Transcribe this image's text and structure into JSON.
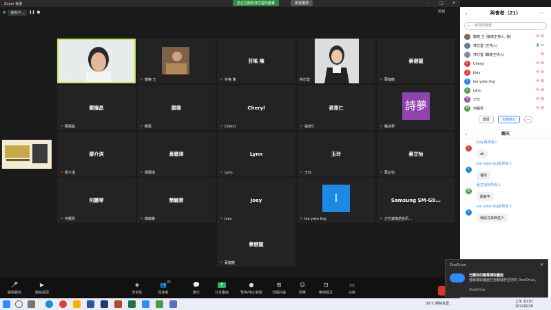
{
  "window": {
    "app_title": "Zoom 會議"
  },
  "share_banner": {
    "text": "您正在觀看林芯瑩的螢幕",
    "stop_label": "檢視選項"
  },
  "top_mini": {
    "recording": "錄製中...",
    "view": "檢視"
  },
  "tiles": [
    {
      "name": "林芯瑩",
      "label": "林芯瑩",
      "kind": "photo-face",
      "active": true,
      "muted": false
    },
    {
      "name": "鄒曉 王",
      "label": "鄒曉 王",
      "kind": "photo-small",
      "muted": true
    },
    {
      "name": "芬瑤 陳",
      "label": "芬瑤 陳",
      "kind": "text",
      "muted": true
    },
    {
      "name": "林芯瑩",
      "label": "林芯瑩",
      "kind": "photo-portrait",
      "muted": false
    },
    {
      "name": "蔡健龍",
      "label": "蔡健龍",
      "kind": "text",
      "muted": true
    },
    {
      "name": "鄭揚昌",
      "label": "鄭揚昌",
      "kind": "text",
      "muted": true
    },
    {
      "name": "顏雯",
      "label": "顏雯",
      "kind": "text",
      "muted": true
    },
    {
      "name": "Cheryl",
      "label": "Cheryl",
      "kind": "text",
      "muted": true
    },
    {
      "name": "張尊仁",
      "label": "張尊仁",
      "kind": "text",
      "muted": true
    },
    {
      "name": "詩夢",
      "label": "羅詩夢",
      "kind": "avatar",
      "avatar_color": "#8e44ad",
      "muted": true
    },
    {
      "name": "廖介淇",
      "label": "廖介淇",
      "kind": "text",
      "muted": true
    },
    {
      "name": "黃聰琪",
      "label": "黃聰琪",
      "kind": "text",
      "muted": true
    },
    {
      "name": "Lynn",
      "label": "Lynn",
      "kind": "text",
      "muted": true
    },
    {
      "name": "玉玲",
      "label": "王玲",
      "kind": "text",
      "muted": true
    },
    {
      "name": "蔡芷怡",
      "label": "蔡芷怡",
      "kind": "text",
      "muted": true
    },
    {
      "name": "何麗琴",
      "label": "何麗琴",
      "kind": "text",
      "muted": true
    },
    {
      "name": "簡毓萊",
      "label": "簡毓萊",
      "kind": "text",
      "muted": true
    },
    {
      "name": "Joey",
      "label": "Joey",
      "kind": "text",
      "muted": true
    },
    {
      "name": "l",
      "label": "lee yoke ling",
      "kind": "avatar",
      "avatar_color": "#1e88e5",
      "muted": true
    },
    {
      "name": "Samsung SM-G9...",
      "label": "正在連接語音訊...",
      "kind": "text",
      "muted": true
    },
    {
      "name": "蔡健龍",
      "label": "蔡健龍",
      "kind": "text",
      "muted": true
    }
  ],
  "toolbar": {
    "items": [
      {
        "label": "解除靜音",
        "icon": "microphone-icon"
      },
      {
        "label": "開始視訊",
        "icon": "video-camera-icon"
      },
      {
        "label": "安全性",
        "icon": "shield-icon"
      },
      {
        "label": "與會者",
        "icon": "participants-icon",
        "badge": "21"
      },
      {
        "label": "聊天",
        "icon": "chat-icon"
      },
      {
        "label": "分享畫面",
        "icon": "share-screen-icon"
      },
      {
        "label": "暫停/停止錄製",
        "icon": "record-icon"
      },
      {
        "label": "分組討論",
        "icon": "breakout-icon"
      },
      {
        "label": "回應",
        "icon": "reaction-icon"
      },
      {
        "label": "應用程式",
        "icon": "apps-icon"
      },
      {
        "label": "白板",
        "icon": "whiteboard-icon"
      }
    ]
  },
  "participants": {
    "title": "與會者（21）",
    "search_placeholder": "尋找與會者",
    "list": [
      {
        "name": "鄒曉 王 (聯席主持人, 我)",
        "initial": "",
        "color": "#7a6a5a",
        "photo": true,
        "icons": "mic-muted video-off"
      },
      {
        "name": "林芯瑩 (主持人)",
        "initial": "",
        "color": "#6b7b8c",
        "photo": true,
        "icons": "mic video"
      },
      {
        "name": "林芯瑩 (聯席主持人)",
        "initial": "",
        "color": "#8a8a8a",
        "photo": true,
        "icons": "video-off"
      },
      {
        "name": "Cheryl",
        "initial": "C",
        "color": "#e53935",
        "icons": "mic-muted video-off"
      },
      {
        "name": "Joey",
        "initial": "J",
        "color": "#e53935",
        "icons": "mic-muted video-off"
      },
      {
        "name": "lee yoke ling",
        "initial": "l",
        "color": "#1e88e5",
        "icons": "mic-muted video-off"
      },
      {
        "name": "Lynn",
        "initial": "L",
        "color": "#43a047",
        "icons": "mic-muted video-off"
      },
      {
        "name": "王玲",
        "initial": "玉",
        "color": "#8e44ad",
        "icons": "mic-muted video-off"
      },
      {
        "name": "何麗琴",
        "initial": "何",
        "color": "#43a047",
        "icons": "mic-muted video-off"
      }
    ],
    "invite": "邀請",
    "mute_all": "全體靜音",
    "more": "..."
  },
  "chat": {
    "title": "聊天",
    "messages": [
      {
        "from": "Joey對所有人",
        "text": "ok",
        "initial": "J",
        "color": "#e53935"
      },
      {
        "from": "lee yoke ling對所有人",
        "text": "會的",
        "initial": "l",
        "color": "#1e88e5"
      },
      {
        "from": "蔡芷怡對所有人",
        "text": "開會中",
        "initial": "蔡",
        "color": "#43a047"
      },
      {
        "from": "lee yoke ling對所有人",
        "text": "我是马来西亚人",
        "initial": "l",
        "color": "#1e88e5"
      }
    ]
  },
  "toast": {
    "app": "OneDrive",
    "title": "已關存的螢幕擷取畫面",
    "body": "螢幕擷取畫面已自動儲存至您的 OneDrive。",
    "footer": "OneDrive"
  },
  "taskbar": {
    "weather": "30°C 晴時多雲",
    "time": "上午 10:07",
    "date": "2022/6/28"
  }
}
